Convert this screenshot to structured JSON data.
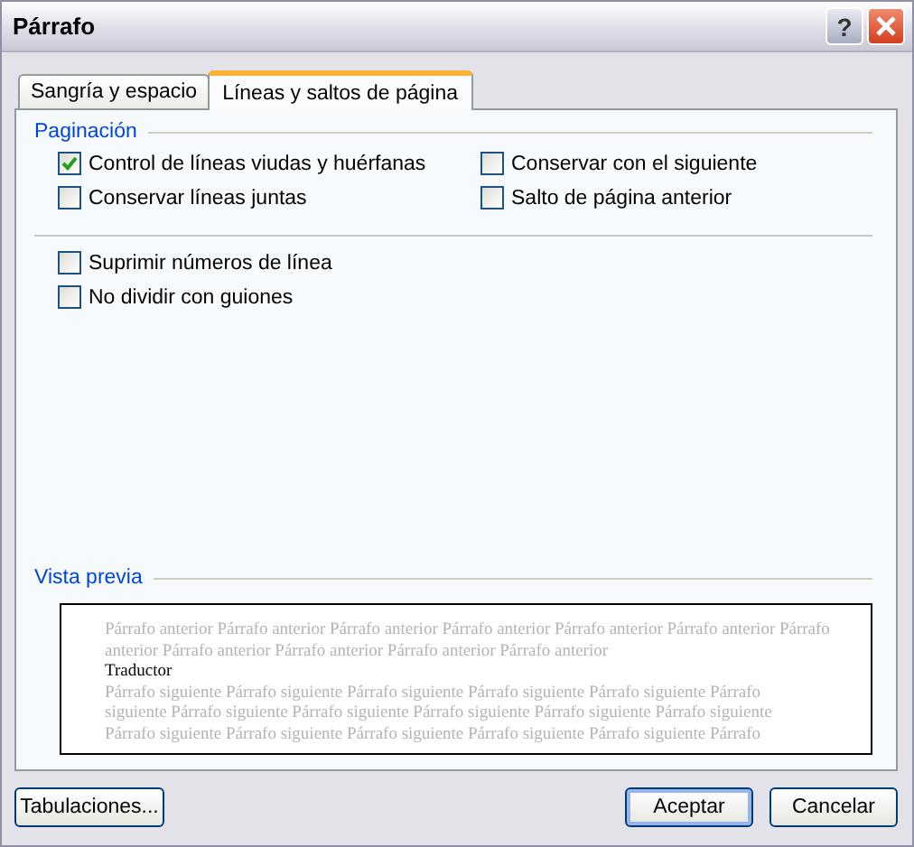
{
  "window": {
    "title": "Párrafo"
  },
  "title_buttons": [
    {
      "kind": "help",
      "label": "?"
    },
    {
      "kind": "close"
    }
  ],
  "tabs": [
    {
      "label": "Sangría y espacio",
      "selected": false
    },
    {
      "label": "Líneas y saltos de página",
      "selected": true
    }
  ],
  "pagination": {
    "legend": "Paginación",
    "options": [
      {
        "label": "Control de líneas viudas y huérfanas",
        "checked": true
      },
      {
        "label": "Conservar con el siguiente",
        "checked": false
      },
      {
        "label": "Conservar líneas juntas",
        "checked": false
      },
      {
        "label": "Salto de página anterior",
        "checked": false
      }
    ]
  },
  "other_options": [
    {
      "label": "Suprimir números de línea",
      "checked": false
    },
    {
      "label": "No dividir con guiones",
      "checked": false
    }
  ],
  "preview": {
    "legend": "Vista previa",
    "lines": [
      {
        "kind": "previous",
        "text": "Párrafo anterior Párrafo anterior Párrafo anterior Párrafo anterior Párrafo anterior Párrafo anterior Párrafo"
      },
      {
        "kind": "previous",
        "text": "anterior Párrafo anterior Párrafo anterior Párrafo anterior Párrafo anterior"
      },
      {
        "kind": "current",
        "text": "Traductor"
      },
      {
        "kind": "next",
        "text": "Párrafo siguiente Párrafo siguiente Párrafo siguiente Párrafo siguiente Párrafo siguiente Párrafo"
      },
      {
        "kind": "next",
        "text": "siguiente Párrafo siguiente Párrafo siguiente Párrafo siguiente Párrafo siguiente Párrafo siguiente"
      },
      {
        "kind": "next",
        "text": "Párrafo siguiente Párrafo siguiente Párrafo siguiente Párrafo siguiente Párrafo siguiente Párrafo"
      }
    ]
  },
  "buttons": [
    {
      "label": "Tabulaciones...",
      "kind": "left"
    },
    {
      "label": "Aceptar",
      "kind": "default"
    },
    {
      "label": "Cancelar",
      "kind": "normal"
    }
  ]
}
